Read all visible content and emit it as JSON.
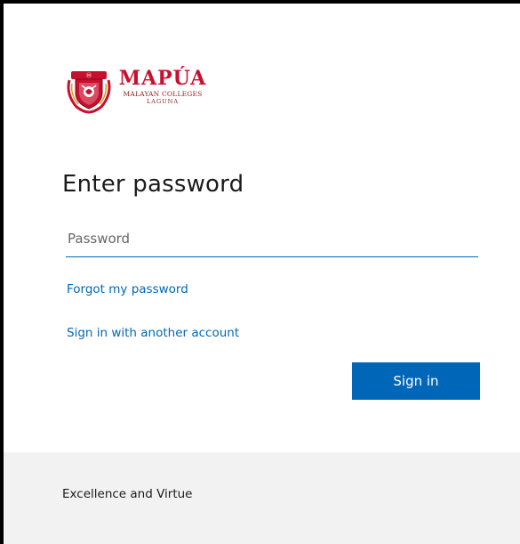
{
  "brand": {
    "name": "MAPÚA",
    "line1": "MALAYAN COLLEGES",
    "line2": "LAGUNA",
    "logo_icon": "crest-icon",
    "color": "#c8102e"
  },
  "page": {
    "title": "Enter password"
  },
  "password": {
    "placeholder": "Password",
    "value": ""
  },
  "links": {
    "forgot": "Forgot my password",
    "another_account": "Sign in with another account"
  },
  "actions": {
    "sign_in_label": "Sign in",
    "primary_color": "#0067b8"
  },
  "footer": {
    "text": "Excellence and Virtue"
  }
}
